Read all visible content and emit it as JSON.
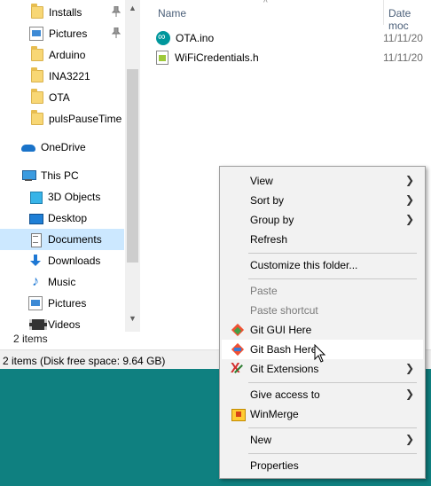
{
  "nav": {
    "items": [
      {
        "label": "Installs",
        "icon": "folder-icon",
        "pinned": true
      },
      {
        "label": "Pictures",
        "icon": "pictures-icon",
        "pinned": true
      },
      {
        "label": "Arduino",
        "icon": "folder-icon"
      },
      {
        "label": "INA3221",
        "icon": "folder-icon"
      },
      {
        "label": "OTA",
        "icon": "folder-icon"
      },
      {
        "label": "pulsPauseTime",
        "icon": "folder-icon"
      },
      {
        "label": "OneDrive",
        "icon": "onedrive-icon"
      },
      {
        "label": "This PC",
        "icon": "this-pc-icon"
      },
      {
        "label": "3D Objects",
        "icon": "3d-objects-icon"
      },
      {
        "label": "Desktop",
        "icon": "desktop-icon"
      },
      {
        "label": "Documents",
        "icon": "documents-icon",
        "selected": true
      },
      {
        "label": "Downloads",
        "icon": "downloads-icon"
      },
      {
        "label": "Music",
        "icon": "music-icon"
      },
      {
        "label": "Pictures",
        "icon": "pictures-icon"
      },
      {
        "label": "Videos",
        "icon": "videos-icon"
      }
    ]
  },
  "items_count": "2 items",
  "status_bar": "2 items (Disk free space: 9.64 GB)",
  "file_list": {
    "columns": [
      "Name",
      "Date moc"
    ],
    "files": [
      {
        "name": "OTA.ino",
        "date": "11/11/20",
        "icon": "arduino-icon"
      },
      {
        "name": "WiFiCredentials.h",
        "date": "11/11/20",
        "icon": "header-file-icon"
      }
    ]
  },
  "context_menu": {
    "items": [
      {
        "label": "View",
        "submenu": true
      },
      {
        "label": "Sort by",
        "submenu": true
      },
      {
        "label": "Group by",
        "submenu": true
      },
      {
        "label": "Refresh"
      },
      {
        "label": "Customize this folder..."
      },
      {
        "label": "Paste",
        "disabled": true
      },
      {
        "label": "Paste shortcut",
        "disabled": true
      },
      {
        "label": "Git GUI Here",
        "icon": "git-gui-icon"
      },
      {
        "label": "Git Bash Here",
        "icon": "git-bash-icon",
        "hover": true
      },
      {
        "label": "Git Extensions",
        "icon": "git-extensions-icon",
        "submenu": true
      },
      {
        "label": "Give access to",
        "submenu": true
      },
      {
        "label": "WinMerge",
        "icon": "winmerge-icon"
      },
      {
        "label": "New",
        "submenu": true
      },
      {
        "label": "Properties"
      }
    ]
  },
  "colors": {
    "selection": "#cce8ff",
    "desktop": "#0f8080",
    "menu_bg": "#f2f2f2"
  }
}
